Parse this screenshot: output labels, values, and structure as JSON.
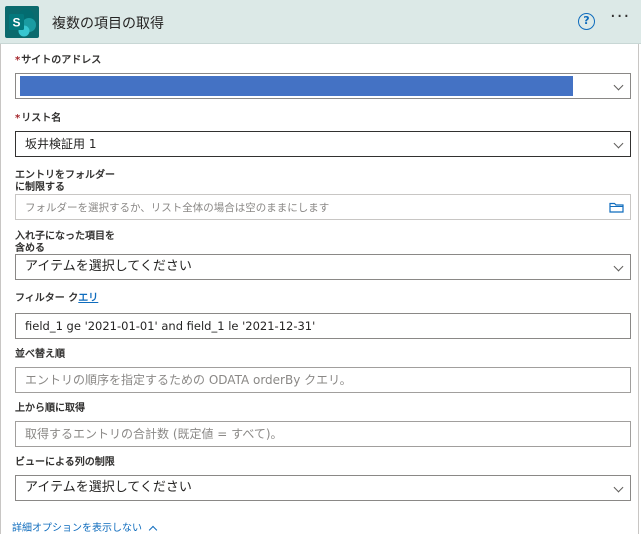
{
  "header": {
    "title": "複数の項目の取得",
    "help_symbol": "?",
    "more_symbol": "···",
    "logo_letter": "S"
  },
  "fields": {
    "site": {
      "label": "サイトのアドレス",
      "required_mark": "*",
      "value": ""
    },
    "list": {
      "label": "リスト名",
      "required_mark": "*",
      "value": "坂井検証用 1"
    },
    "folder": {
      "label_line1": "エントリをフォルダー",
      "label_line2": "に制限する",
      "placeholder": "フォルダーを選択するか、リスト全体の場合は空のままにします"
    },
    "nested": {
      "label_line1": "入れ子になった項目を",
      "label_line2": "含める",
      "value": "アイテムを選択してください"
    },
    "filter": {
      "label_prefix": "フィルター ク",
      "label_link": "エリ",
      "value": "field_1 ge '2021-01-01' and field_1 le '2021-12-31'"
    },
    "orderby": {
      "label": "並べ替え順",
      "placeholder": "エントリの順序を指定するための ODATA orderBy クエリ。"
    },
    "top": {
      "label": "上から順に取得",
      "placeholder": "取得するエントリの合計数 (既定値 = すべて)。"
    },
    "view": {
      "label": "ビューによる列の制限",
      "value": "アイテムを選択してください"
    }
  },
  "footer": {
    "advanced_link": "詳細オプションを表示しない"
  },
  "colors": {
    "accent": "#0f6cbd",
    "header_bg": "#dce9e7",
    "redaction": "#4472c4",
    "sharepoint": "#038387"
  }
}
